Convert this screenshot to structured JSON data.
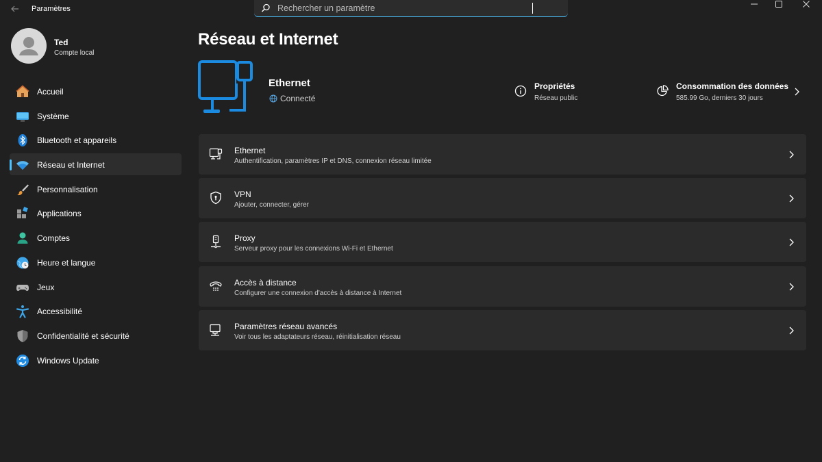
{
  "window": {
    "title": "Paramètres"
  },
  "search": {
    "placeholder": "Rechercher un paramètre"
  },
  "profile": {
    "name": "Ted",
    "account_type": "Compte local"
  },
  "sidebar": {
    "items": [
      {
        "label": "Accueil",
        "icon": "home-icon"
      },
      {
        "label": "Système",
        "icon": "system-icon"
      },
      {
        "label": "Bluetooth et appareils",
        "icon": "bluetooth-icon"
      },
      {
        "label": "Réseau et Internet",
        "icon": "network-icon",
        "active": true
      },
      {
        "label": "Personnalisation",
        "icon": "brush-icon"
      },
      {
        "label": "Applications",
        "icon": "apps-icon"
      },
      {
        "label": "Comptes",
        "icon": "account-icon"
      },
      {
        "label": "Heure et langue",
        "icon": "clock-globe-icon"
      },
      {
        "label": "Jeux",
        "icon": "gamepad-icon"
      },
      {
        "label": "Accessibilité",
        "icon": "accessibility-icon"
      },
      {
        "label": "Confidentialité et sécurité",
        "icon": "shield-icon"
      },
      {
        "label": "Windows Update",
        "icon": "update-icon"
      }
    ]
  },
  "main": {
    "title": "Réseau et Internet",
    "connection": {
      "name": "Ethernet",
      "status": "Connecté"
    },
    "properties": {
      "title": "Propriétés",
      "subtitle": "Réseau public"
    },
    "data_usage": {
      "title": "Consommation des données",
      "subtitle": "585.99 Go, derniers 30 jours"
    },
    "cards": [
      {
        "title": "Ethernet",
        "subtitle": "Authentification, paramètres IP et DNS, connexion réseau limitée",
        "icon": "ethernet-icon"
      },
      {
        "title": "VPN",
        "subtitle": "Ajouter, connecter, gérer",
        "icon": "vpn-shield-icon"
      },
      {
        "title": "Proxy",
        "subtitle": "Serveur proxy pour les connexions Wi-Fi et Ethernet",
        "icon": "proxy-icon"
      },
      {
        "title": "Accès à distance",
        "subtitle": "Configurer une connexion d'accès à distance à Internet",
        "icon": "dialup-icon"
      },
      {
        "title": "Paramètres réseau avancés",
        "subtitle": "Voir tous les adaptateurs réseau, réinitialisation réseau",
        "icon": "advanced-network-icon"
      }
    ]
  },
  "colors": {
    "accent": "#4cc2ff",
    "hero_blue": "#1a8be0",
    "background": "#202020",
    "card": "#2b2b2b"
  }
}
